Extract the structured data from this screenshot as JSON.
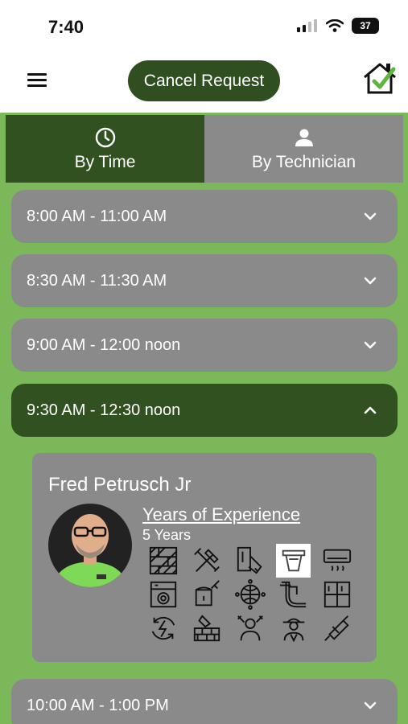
{
  "status_bar": {
    "time": "7:40",
    "battery": "37"
  },
  "header": {
    "cancel_label": "Cancel Request"
  },
  "tabs": [
    {
      "label": "By Time",
      "icon": "clock-icon",
      "active": true
    },
    {
      "label": "By Technician",
      "icon": "person-icon",
      "active": false
    }
  ],
  "slots": [
    {
      "label": "8:00 AM - 11:00 AM",
      "expanded": false
    },
    {
      "label": "8:30 AM - 11:30 AM",
      "expanded": false
    },
    {
      "label": "9:00 AM - 12:00 noon",
      "expanded": false
    },
    {
      "label": "9:30 AM - 12:30 noon",
      "expanded": true
    },
    {
      "label": "10:00 AM - 1:00 PM",
      "expanded": false
    }
  ],
  "technician": {
    "name": "Fred Petrusch Jr",
    "experience_label": "Years of Experience",
    "experience_value": "5 Years",
    "skills": [
      "flooring-icon",
      "carpentry-tools-icon",
      "drywall-icon",
      "countertop-icon",
      "air-conditioner-icon",
      "appliance-icon",
      "painting-icon",
      "network-icon",
      "plumbing-icon",
      "tile-icon",
      "electrical-icon",
      "masonry-icon",
      "handyman-icon",
      "technician-icon",
      "caulking-icon"
    ],
    "selected_skill": "countertop-icon"
  },
  "colors": {
    "background": "#7bb85a",
    "dark_green": "#315220",
    "gray": "#8a8a8a",
    "check_green": "#5fb43a"
  }
}
